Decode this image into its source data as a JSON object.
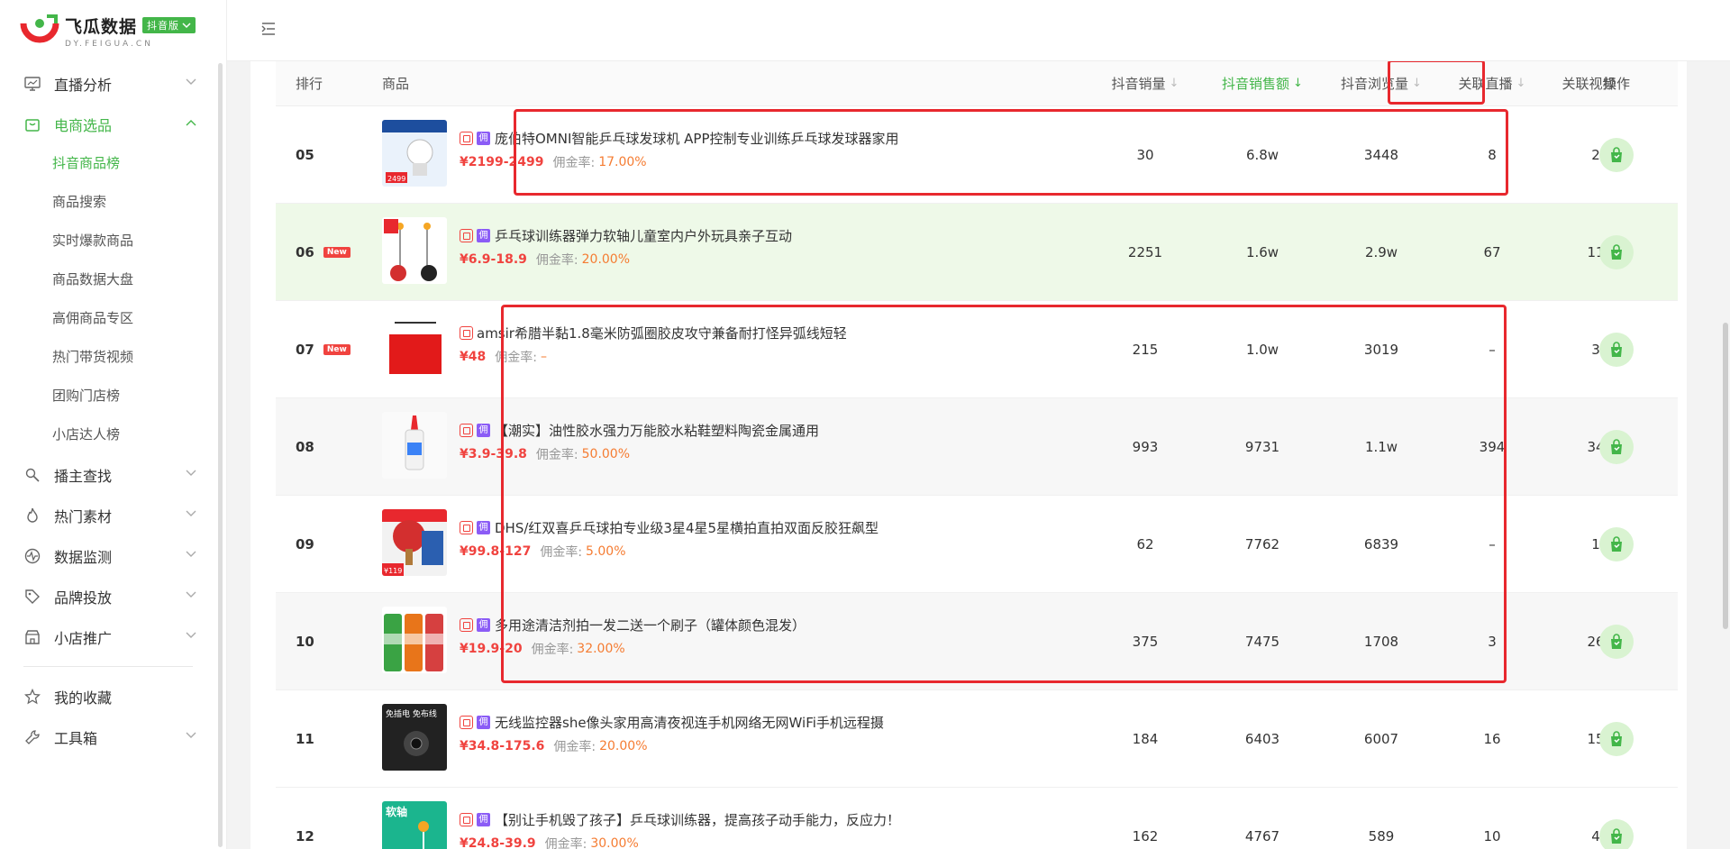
{
  "brand": {
    "title": "飞瓜数据",
    "badge": "抖音版",
    "subtitle": "DY.FEIGUA.CN"
  },
  "sidebar": {
    "items": [
      {
        "label": "直播分析",
        "icon": "monitor-icon",
        "expandable": true
      },
      {
        "label": "电商选品",
        "icon": "shop-bag-icon",
        "expandable": true,
        "active": true,
        "children": [
          {
            "label": "抖音商品榜",
            "active": true
          },
          {
            "label": "商品搜索"
          },
          {
            "label": "实时爆款商品"
          },
          {
            "label": "商品数据大盘"
          },
          {
            "label": "高佣商品专区"
          },
          {
            "label": "热门带货视频"
          },
          {
            "label": "团购门店榜"
          },
          {
            "label": "小店达人榜"
          }
        ]
      },
      {
        "label": "播主查找",
        "icon": "search-person-icon",
        "expandable": true
      },
      {
        "label": "热门素材",
        "icon": "flame-icon",
        "expandable": true
      },
      {
        "label": "数据监测",
        "icon": "pulse-icon",
        "expandable": true
      },
      {
        "label": "品牌投放",
        "icon": "tag-icon",
        "expandable": true
      },
      {
        "label": "小店推广",
        "icon": "store-icon",
        "expandable": true
      },
      {
        "label": "我的收藏",
        "icon": "star-icon",
        "expandable": false
      },
      {
        "label": "工具箱",
        "icon": "wrench-icon",
        "expandable": true
      }
    ]
  },
  "table": {
    "headers": {
      "rank": "排行",
      "product": "商品",
      "sales": "抖音销量",
      "revenue": "抖音销售额",
      "views": "抖音浏览量",
      "live": "关联直播",
      "video": "关联视频",
      "action": "操作"
    },
    "rate_label": "佣金率:",
    "new_label": "New",
    "rows": [
      {
        "rank": "05",
        "is_new": false,
        "has_yong": true,
        "title": "庞伯特OMNI智能乒乓球发球机 APP控制专业训练乒乓球发球器家用",
        "price": "¥2199-2499",
        "rate": "17.00%",
        "sales": "30",
        "revenue": "6.8w",
        "views": "3448",
        "live": "8",
        "video": "2",
        "thumb": "machine"
      },
      {
        "rank": "06",
        "is_new": true,
        "has_yong": true,
        "title": "乒乓球训练器弹力软轴儿童室内户外玩具亲子互动",
        "price": "¥6.9-18.9",
        "rate": "20.00%",
        "sales": "2251",
        "revenue": "1.6w",
        "views": "2.9w",
        "live": "67",
        "video": "11",
        "thumb": "trainer"
      },
      {
        "rank": "07",
        "is_new": true,
        "has_yong": false,
        "title": "amsir希腊半黏1.8毫米防弧圈胶皮攻守兼备耐打怪异弧线短轻",
        "price": "¥48",
        "rate": "–",
        "sales": "215",
        "revenue": "1.0w",
        "views": "3019",
        "live": "–",
        "video": "3",
        "thumb": "rubber"
      },
      {
        "rank": "08",
        "is_new": false,
        "has_yong": true,
        "title": "【潮实】油性胶水强力万能胶水粘鞋塑料陶瓷金属通用",
        "price": "¥3.9-39.8",
        "rate": "50.00%",
        "sales": "993",
        "revenue": "9731",
        "views": "1.1w",
        "live": "394",
        "video": "34",
        "thumb": "glue"
      },
      {
        "rank": "09",
        "is_new": false,
        "has_yong": true,
        "title": "DHS/红双喜乒乓球拍专业级3星4星5星横拍直拍双面反胶狂飙型",
        "price": "¥99.8-127",
        "rate": "5.00%",
        "sales": "62",
        "revenue": "7762",
        "views": "6839",
        "live": "–",
        "video": "1",
        "thumb": "racket"
      },
      {
        "rank": "10",
        "is_new": false,
        "has_yong": true,
        "title": "多用途清洁剂拍一发二送一个刷子（罐体颜色混发）",
        "price": "¥19.9-20",
        "rate": "32.00%",
        "sales": "375",
        "revenue": "7475",
        "views": "1708",
        "live": "3",
        "video": "26",
        "thumb": "cans"
      },
      {
        "rank": "11",
        "is_new": false,
        "has_yong": true,
        "title": "无线监控器she像头家用高清夜视连手机网络无网WiFi手机远程摄",
        "price": "¥34.8-175.6",
        "rate": "20.00%",
        "sales": "184",
        "revenue": "6403",
        "views": "6007",
        "live": "16",
        "video": "15",
        "thumb": "camera"
      },
      {
        "rank": "12",
        "is_new": false,
        "has_yong": true,
        "title": "【别让手机毁了孩子】乒乓球训练器，提高孩子动手能力，反应力！",
        "price": "¥24.8-39.9",
        "rate": "30.00%",
        "sales": "162",
        "revenue": "4767",
        "views": "589",
        "live": "10",
        "video": "4",
        "thumb": "trainer2"
      }
    ],
    "thumb_text": {
      "machine_price": "2499",
      "trainer2_label": "软轴",
      "camera_label": "免插电 免布线",
      "racket_price": "¥119"
    }
  },
  "colors": {
    "brand_green": "#43b649",
    "price_red": "#f0433f",
    "rate_orange": "#f57c32",
    "annotation_red": "#e8282e"
  }
}
